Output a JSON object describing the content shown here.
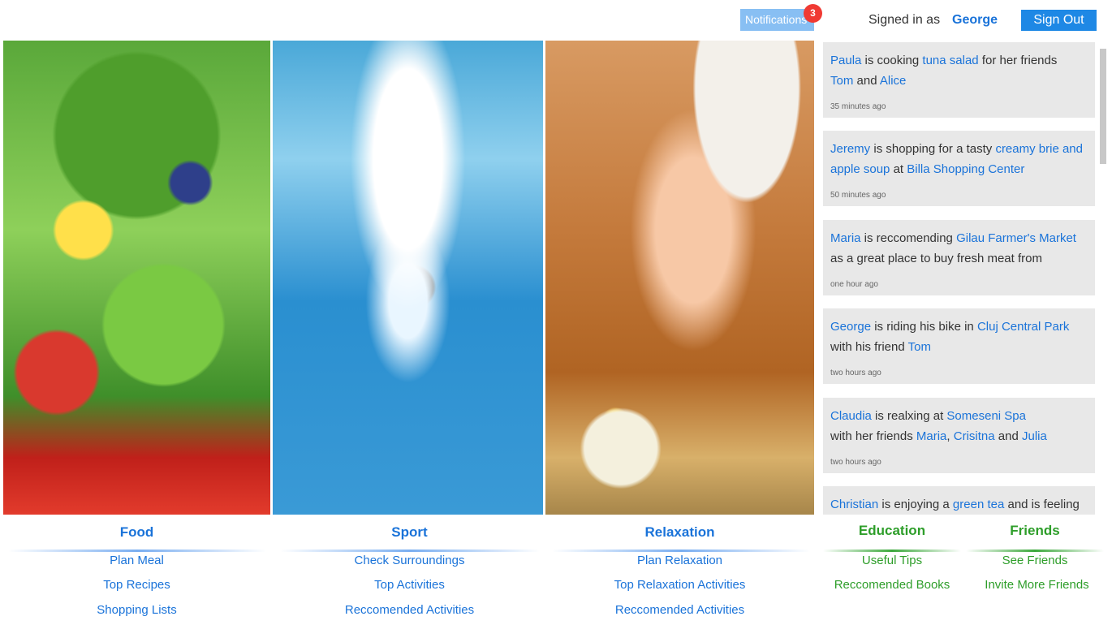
{
  "header": {
    "notifications_label": "Notifications",
    "notifications_count": "3",
    "signed_in_label": "Signed in as",
    "user_name": "George",
    "sign_out_label": "Sign Out"
  },
  "feed": {
    "items": [
      {
        "parts": [
          [
            "Paula",
            "link"
          ],
          [
            " is cooking ",
            "text"
          ],
          [
            "tuna salad",
            "link"
          ],
          [
            " for her friends",
            "text"
          ]
        ],
        "parts2": [
          [
            "Tom",
            "link"
          ],
          [
            " and ",
            "text"
          ],
          [
            "Alice",
            "link"
          ]
        ],
        "time": "35 minutes ago"
      },
      {
        "parts": [
          [
            "Jeremy",
            "link"
          ],
          [
            " is shopping for a tasty ",
            "text"
          ],
          [
            "creamy brie and",
            "link"
          ]
        ],
        "parts2": [
          [
            "apple soup",
            "link"
          ],
          [
            " at ",
            "text"
          ],
          [
            "Billa Shopping Center",
            "link"
          ]
        ],
        "time": "50 minutes ago"
      },
      {
        "parts": [
          [
            "Maria",
            "link"
          ],
          [
            " is reccomending ",
            "text"
          ],
          [
            "Gilau Farmer's Market",
            "link"
          ]
        ],
        "parts2": [
          [
            "as a great place to buy fresh meat from",
            "text"
          ]
        ],
        "time": "one hour ago"
      },
      {
        "parts": [
          [
            "George",
            "link"
          ],
          [
            " is riding his bike in ",
            "text"
          ],
          [
            "Cluj Central Park",
            "link"
          ]
        ],
        "parts2": [
          [
            "with his friend ",
            "text"
          ],
          [
            "Tom",
            "link"
          ]
        ],
        "time": "two hours ago"
      },
      {
        "parts": [
          [
            "Claudia",
            "link"
          ],
          [
            " is realxing at ",
            "text"
          ],
          [
            "Someseni Spa",
            "link"
          ]
        ],
        "parts2": [
          [
            "with her friends ",
            "text"
          ],
          [
            "Maria",
            "link"
          ],
          [
            ", ",
            "text"
          ],
          [
            "Crisitna",
            "link"
          ],
          [
            " and ",
            "text"
          ],
          [
            "Julia",
            "link"
          ]
        ],
        "time": "two hours ago"
      },
      {
        "parts": [
          [
            "Christian",
            "link"
          ],
          [
            " is enjoying a ",
            "text"
          ],
          [
            "green tea",
            "link"
          ],
          [
            " and is feeling",
            "text"
          ]
        ],
        "parts2": [],
        "time": ""
      }
    ]
  },
  "categories": {
    "food": {
      "title": "Food",
      "links": [
        "Plan Meal",
        "Top Recipes",
        "Shopping Lists"
      ]
    },
    "sport": {
      "title": "Sport",
      "links": [
        "Check Surroundings",
        "Top Activities",
        "Reccomended Activities"
      ]
    },
    "relaxation": {
      "title": "Relaxation",
      "links": [
        "Plan Relaxation",
        "Top Relaxation Activities",
        "Reccomended Activities"
      ]
    },
    "education": {
      "title": "Education",
      "links": [
        "Useful Tips",
        "Reccomended Books"
      ]
    },
    "friends": {
      "title": "Friends",
      "links": [
        "See Friends",
        "Invite More Friends"
      ]
    }
  },
  "colors": {
    "link_blue": "#1a73d9",
    "link_green": "#2e9e2a",
    "notif_bg": "#88bff3",
    "badge_red": "#f03a33",
    "signout_bg": "#1e88e5",
    "feed_bg": "#e8e8e8"
  }
}
